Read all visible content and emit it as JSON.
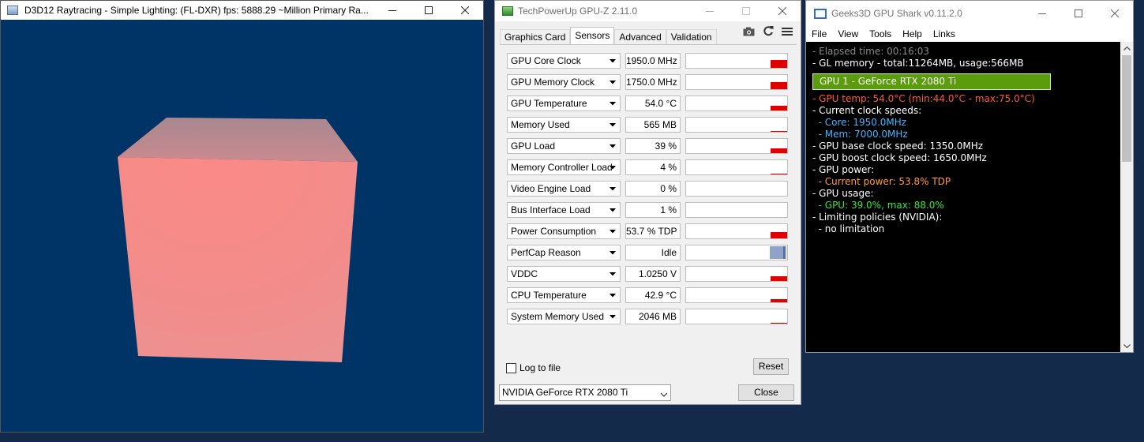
{
  "d3d_window": {
    "title": "D3D12 Raytracing - Simple Lighting: (FL-DXR)    fps: 5888.29     ~Million Primary Ra...",
    "background_color": "#003466",
    "cube_color": "#f48a86"
  },
  "gpuz": {
    "title": "TechPowerUp GPU-Z 2.11.0",
    "tabs": [
      {
        "label": "Graphics Card",
        "active": false
      },
      {
        "label": "Sensors",
        "active": true
      },
      {
        "label": "Advanced",
        "active": false
      },
      {
        "label": "Validation",
        "active": false
      }
    ],
    "toolbar_icons": [
      "camera-icon",
      "refresh-icon",
      "menu-icon"
    ],
    "sensors": [
      {
        "name": "GPU Core Clock",
        "value": "1950.0 MHz",
        "graph_level": 0.55
      },
      {
        "name": "GPU Memory Clock",
        "value": "1750.0 MHz",
        "graph_level": 0.5
      },
      {
        "name": "GPU Temperature",
        "value": "54.0 °C",
        "graph_level": 0.35
      },
      {
        "name": "Memory Used",
        "value": "565 MB",
        "graph_level": 0.05
      },
      {
        "name": "GPU Load",
        "value": "39 %",
        "graph_level": 0.35
      },
      {
        "name": "Memory Controller Load",
        "value": "4 %",
        "graph_level": 0.05
      },
      {
        "name": "Video Engine Load",
        "value": "0 %",
        "graph_level": 0
      },
      {
        "name": "Bus Interface Load",
        "value": "1 %",
        "graph_level": 0
      },
      {
        "name": "Power Consumption",
        "value": "53.7 % TDP",
        "graph_level": 0.45
      },
      {
        "name": "PerfCap Reason",
        "value": "Idle",
        "graph_level": 1
      },
      {
        "name": "VDDC",
        "value": "1.0250 V",
        "graph_level": 0.35
      },
      {
        "name": "CPU Temperature",
        "value": "42.9 °C",
        "graph_level": 0.2
      },
      {
        "name": "System Memory Used",
        "value": "2046 MB",
        "graph_level": 0.05
      }
    ],
    "log_to_file_label": "Log to file",
    "log_to_file_checked": false,
    "reset_label": "Reset",
    "gpu_select_value": "NVIDIA GeForce RTX 2080 Ti",
    "close_label": "Close",
    "graph_color": "#e00000"
  },
  "shark": {
    "title": "Geeks3D GPU Shark v0.11.2.0",
    "menu": [
      "File",
      "View",
      "Tools",
      "Help",
      "Links"
    ],
    "elapsed": "- Elapsed time: 00:16:03",
    "gl_memory": "- GL memory - total:11264MB, usage:566MB",
    "gpu_banner": "GPU 1 - GeForce RTX 2080 Ti",
    "gpu_temp": "- GPU temp: 54.0°C (min:44.0°C - max:75.0°C)",
    "clock_header": "- Current clock speeds:",
    "core_clock": "  - Core: 1950.0MHz",
    "mem_clock": "  - Mem: 7000.0MHz",
    "base_clock": "- GPU base clock speed: 1350.0MHz",
    "boost_clock": "- GPU boost clock speed: 1650.0MHz",
    "power_header": "- GPU power:",
    "current_power": "  - Current power: 53.8% TDP",
    "usage_header": "- GPU usage:",
    "gpu_usage": "  - GPU: 39.0%, max: 88.0%",
    "limiting_header": "- Limiting policies (NVIDIA):",
    "limiting_value": "  - no limitation",
    "banner_color": "#5a9c0c"
  }
}
